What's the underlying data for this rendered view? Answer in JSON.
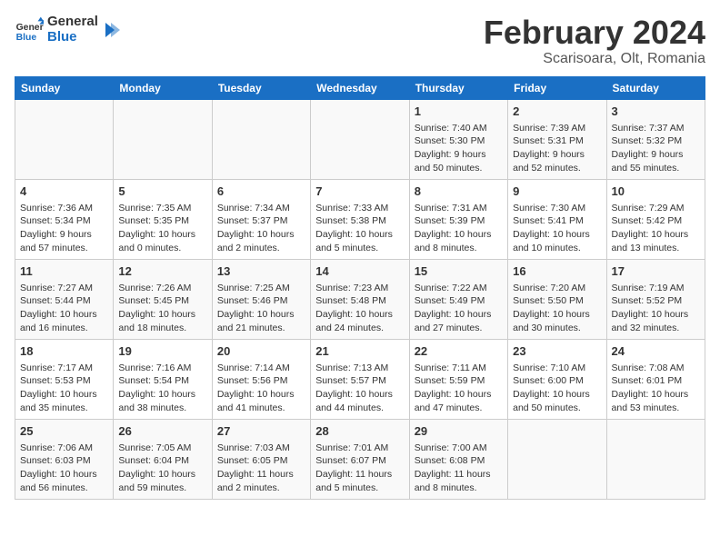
{
  "header": {
    "logo_line1": "General",
    "logo_line2": "Blue",
    "month": "February 2024",
    "location": "Scarisoara, Olt, Romania"
  },
  "days_of_week": [
    "Sunday",
    "Monday",
    "Tuesday",
    "Wednesday",
    "Thursday",
    "Friday",
    "Saturday"
  ],
  "weeks": [
    [
      {
        "day": "",
        "text": ""
      },
      {
        "day": "",
        "text": ""
      },
      {
        "day": "",
        "text": ""
      },
      {
        "day": "",
        "text": ""
      },
      {
        "day": "1",
        "text": "Sunrise: 7:40 AM\nSunset: 5:30 PM\nDaylight: 9 hours\nand 50 minutes."
      },
      {
        "day": "2",
        "text": "Sunrise: 7:39 AM\nSunset: 5:31 PM\nDaylight: 9 hours\nand 52 minutes."
      },
      {
        "day": "3",
        "text": "Sunrise: 7:37 AM\nSunset: 5:32 PM\nDaylight: 9 hours\nand 55 minutes."
      }
    ],
    [
      {
        "day": "4",
        "text": "Sunrise: 7:36 AM\nSunset: 5:34 PM\nDaylight: 9 hours\nand 57 minutes."
      },
      {
        "day": "5",
        "text": "Sunrise: 7:35 AM\nSunset: 5:35 PM\nDaylight: 10 hours\nand 0 minutes."
      },
      {
        "day": "6",
        "text": "Sunrise: 7:34 AM\nSunset: 5:37 PM\nDaylight: 10 hours\nand 2 minutes."
      },
      {
        "day": "7",
        "text": "Sunrise: 7:33 AM\nSunset: 5:38 PM\nDaylight: 10 hours\nand 5 minutes."
      },
      {
        "day": "8",
        "text": "Sunrise: 7:31 AM\nSunset: 5:39 PM\nDaylight: 10 hours\nand 8 minutes."
      },
      {
        "day": "9",
        "text": "Sunrise: 7:30 AM\nSunset: 5:41 PM\nDaylight: 10 hours\nand 10 minutes."
      },
      {
        "day": "10",
        "text": "Sunrise: 7:29 AM\nSunset: 5:42 PM\nDaylight: 10 hours\nand 13 minutes."
      }
    ],
    [
      {
        "day": "11",
        "text": "Sunrise: 7:27 AM\nSunset: 5:44 PM\nDaylight: 10 hours\nand 16 minutes."
      },
      {
        "day": "12",
        "text": "Sunrise: 7:26 AM\nSunset: 5:45 PM\nDaylight: 10 hours\nand 18 minutes."
      },
      {
        "day": "13",
        "text": "Sunrise: 7:25 AM\nSunset: 5:46 PM\nDaylight: 10 hours\nand 21 minutes."
      },
      {
        "day": "14",
        "text": "Sunrise: 7:23 AM\nSunset: 5:48 PM\nDaylight: 10 hours\nand 24 minutes."
      },
      {
        "day": "15",
        "text": "Sunrise: 7:22 AM\nSunset: 5:49 PM\nDaylight: 10 hours\nand 27 minutes."
      },
      {
        "day": "16",
        "text": "Sunrise: 7:20 AM\nSunset: 5:50 PM\nDaylight: 10 hours\nand 30 minutes."
      },
      {
        "day": "17",
        "text": "Sunrise: 7:19 AM\nSunset: 5:52 PM\nDaylight: 10 hours\nand 32 minutes."
      }
    ],
    [
      {
        "day": "18",
        "text": "Sunrise: 7:17 AM\nSunset: 5:53 PM\nDaylight: 10 hours\nand 35 minutes."
      },
      {
        "day": "19",
        "text": "Sunrise: 7:16 AM\nSunset: 5:54 PM\nDaylight: 10 hours\nand 38 minutes."
      },
      {
        "day": "20",
        "text": "Sunrise: 7:14 AM\nSunset: 5:56 PM\nDaylight: 10 hours\nand 41 minutes."
      },
      {
        "day": "21",
        "text": "Sunrise: 7:13 AM\nSunset: 5:57 PM\nDaylight: 10 hours\nand 44 minutes."
      },
      {
        "day": "22",
        "text": "Sunrise: 7:11 AM\nSunset: 5:59 PM\nDaylight: 10 hours\nand 47 minutes."
      },
      {
        "day": "23",
        "text": "Sunrise: 7:10 AM\nSunset: 6:00 PM\nDaylight: 10 hours\nand 50 minutes."
      },
      {
        "day": "24",
        "text": "Sunrise: 7:08 AM\nSunset: 6:01 PM\nDaylight: 10 hours\nand 53 minutes."
      }
    ],
    [
      {
        "day": "25",
        "text": "Sunrise: 7:06 AM\nSunset: 6:03 PM\nDaylight: 10 hours\nand 56 minutes."
      },
      {
        "day": "26",
        "text": "Sunrise: 7:05 AM\nSunset: 6:04 PM\nDaylight: 10 hours\nand 59 minutes."
      },
      {
        "day": "27",
        "text": "Sunrise: 7:03 AM\nSunset: 6:05 PM\nDaylight: 11 hours\nand 2 minutes."
      },
      {
        "day": "28",
        "text": "Sunrise: 7:01 AM\nSunset: 6:07 PM\nDaylight: 11 hours\nand 5 minutes."
      },
      {
        "day": "29",
        "text": "Sunrise: 7:00 AM\nSunset: 6:08 PM\nDaylight: 11 hours\nand 8 minutes."
      },
      {
        "day": "",
        "text": ""
      },
      {
        "day": "",
        "text": ""
      }
    ]
  ]
}
